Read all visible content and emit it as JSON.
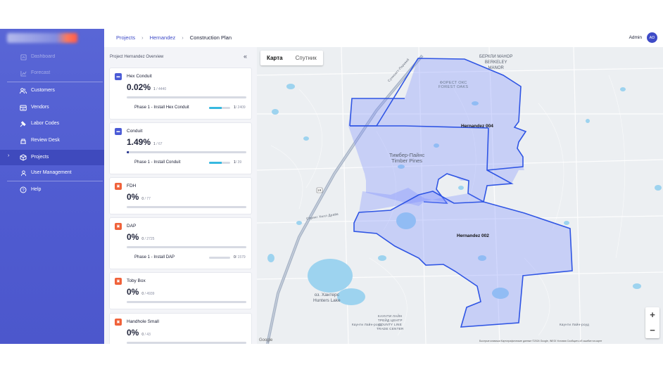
{
  "sidebar": {
    "items": [
      {
        "label": "Dashboard",
        "icon": "dashboard-icon"
      },
      {
        "label": "Forecast",
        "icon": "chart-icon"
      },
      {
        "label": "Customers",
        "icon": "users-icon"
      },
      {
        "label": "Vendors",
        "icon": "vendors-icon"
      },
      {
        "label": "Labor Codes",
        "icon": "labor-codes-icon"
      },
      {
        "label": "Review Desk",
        "icon": "review-desk-icon"
      },
      {
        "label": "Projects",
        "icon": "cube-icon"
      },
      {
        "label": "User Management",
        "icon": "user-icon"
      },
      {
        "label": "Help",
        "icon": "help-icon"
      }
    ]
  },
  "breadcrumb": {
    "items": [
      "Projects",
      "Hernandez",
      "Construction Plan"
    ],
    "separator": "›"
  },
  "user": {
    "name": "Admin",
    "initials": "AD"
  },
  "panel": {
    "title": "Project Hernandez Overview",
    "collapse_glyph": "«"
  },
  "cards": [
    {
      "name": "Hex Conduit",
      "percent": "0.02%",
      "done": "1",
      "total": "/ 4440",
      "progress": 0.0002,
      "tasks": [
        {
          "label": "Phase 1 - Install Hex Conduit",
          "done": "1",
          "total": "/ 2409",
          "progress": 0.6
        }
      ]
    },
    {
      "name": "Conduit",
      "percent": "1.49%",
      "done": "1",
      "total": "/ 67",
      "progress": 0.0149,
      "tasks": [
        {
          "label": "Phase 1 - Install Conduit",
          "done": "1",
          "total": "/ 39",
          "progress": 0.6
        }
      ]
    },
    {
      "name": "FDH",
      "percent": "0%",
      "done": "0",
      "total": "/ 77",
      "progress": 0,
      "tasks": []
    },
    {
      "name": "DAP",
      "percent": "0%",
      "done": "0",
      "total": "/ 2725",
      "progress": 0,
      "tasks": [
        {
          "label": "Phase 1 - Install DAP",
          "done": "0",
          "total": "/ 1579",
          "progress": 0
        }
      ]
    },
    {
      "name": "Toby Box",
      "percent": "0%",
      "done": "0",
      "total": "/ 4939",
      "progress": 0,
      "tasks": []
    },
    {
      "name": "Handhole Small",
      "percent": "0%",
      "done": "0",
      "total": "/ 43",
      "progress": 0,
      "tasks": []
    }
  ],
  "map": {
    "type_tabs": [
      "Карта",
      "Спутник"
    ],
    "polygons": [
      "Hernandez 004",
      "Hernandez 002"
    ],
    "places": {
      "berkeley_manor": "БЕРКЛИ МАНОР\nBERKELEY\nMANOR",
      "forest_oaks": "ФОРЕСТ ОКС\nFOREST OAKS",
      "timber_pines": "Тимбер-Пайнс\nTimber Pines",
      "hunters_lake": "оз. Хантерс\nHunters Lake",
      "county_line_trade": "КАУНТИ ЛАЙН\nТРЕЙД ЦЕНТР\nCOUNTY LINE\nTRADE CENTER"
    },
    "roads": [
      "Спринг Хилл Драйв",
      "Каунти Лайн-роуд",
      "Сункоаст-Парквей"
    ],
    "route_badge": "19",
    "zoom_in": "+",
    "zoom_out": "−",
    "attribution": "Быстрые клавиши   Картографические данные ©2024 Google, INEGI   Условия   Сообщить об ошибке на карте"
  },
  "colors": {
    "accent": "#3e4bc7",
    "polygon_stroke": "#2f55e4",
    "sidebar": "#5361d4"
  }
}
